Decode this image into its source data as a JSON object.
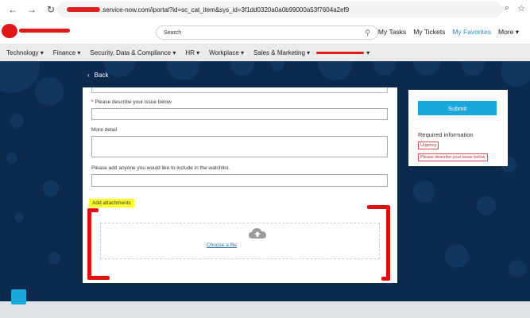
{
  "browser": {
    "back": "←",
    "forward": "→",
    "reload": "↻",
    "url": ".service-now.com/iportal?id=sc_cat_item&sys_id=3f1dd0320a0a0b99000a53f7604a2ef9",
    "zoom_icon": "⌕",
    "star_icon": "☆"
  },
  "header": {
    "search_placeholder": "Search",
    "links": [
      "My Tasks",
      "My Tickets",
      "My Favorites",
      "More ▾"
    ]
  },
  "categories": [
    "Technology ▾",
    "Finance ▾",
    "Security, Data & Compliance ▾",
    "HR ▾",
    "Workplace ▾",
    "Sales & Marketing ▾"
  ],
  "back_label": "Back",
  "form": {
    "issue_label": "Please describe your issue below",
    "detail_label": "More detail",
    "watchlist_label": "Please add anyone you would like to include in the watchlist.",
    "attachments_label": "Add attachments",
    "choose_file": "Choose a file"
  },
  "side": {
    "submit": "Submit",
    "required_title": "Required information",
    "required_items": [
      "Urgency",
      "Please describe your issue below"
    ]
  },
  "colors": {
    "accent": "#1aa7dc",
    "background": "#0b2a4d",
    "annotation": "#e01010"
  }
}
